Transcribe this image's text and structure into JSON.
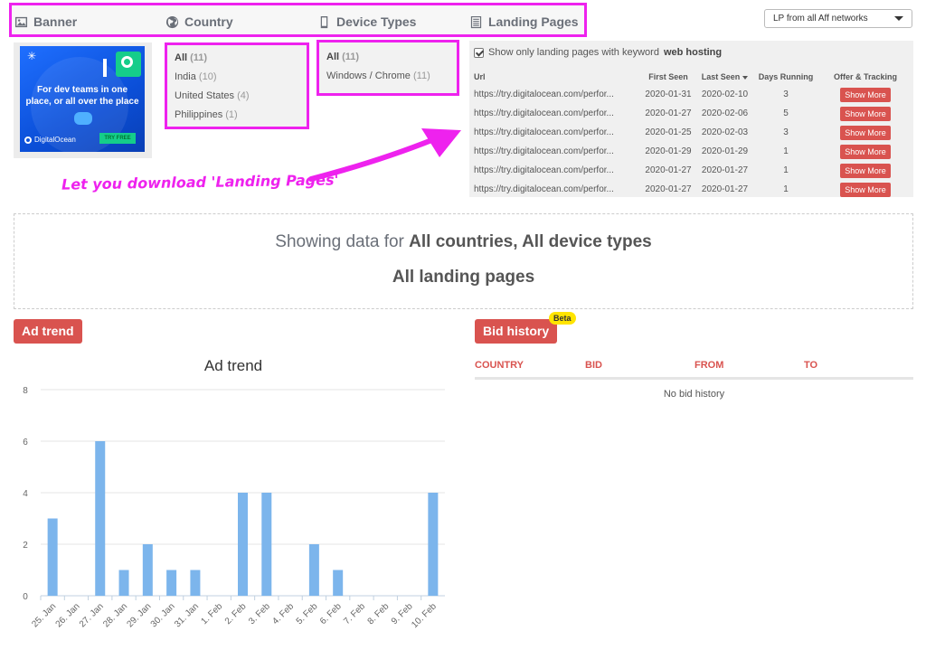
{
  "tabs": [
    {
      "label": "Banner",
      "icon": "image-icon"
    },
    {
      "label": "Country",
      "icon": "globe-icon"
    },
    {
      "label": "Device Types",
      "icon": "mobile-icon"
    },
    {
      "label": "Landing Pages",
      "icon": "list-icon"
    }
  ],
  "network_select": {
    "value": "LP from all Aff networks"
  },
  "banner": {
    "headline": "For dev teams in one place, or all over the place",
    "brand": "DigitalOcean",
    "cta": "TRY FREE"
  },
  "country_filter": [
    {
      "label": "All",
      "count": "(11)",
      "active": true
    },
    {
      "label": "India",
      "count": "(10)",
      "active": false
    },
    {
      "label": "United States",
      "count": "(4)",
      "active": false
    },
    {
      "label": "Philippines",
      "count": "(1)",
      "active": false
    }
  ],
  "device_filter": [
    {
      "label": "All",
      "count": "(11)",
      "active": true
    },
    {
      "label": "Windows / Chrome",
      "count": "(11)",
      "active": false
    }
  ],
  "landing_pages": {
    "checkbox_label": "Show only landing pages with keyword",
    "keyword": "web hosting",
    "columns": [
      "Url",
      "First Seen",
      "Last Seen",
      "Days Running",
      "Offer & Tracking"
    ],
    "rows": [
      {
        "url": "https://try.digitalocean.com/perfor...",
        "first_seen": "2020-01-31",
        "last_seen": "2020-02-10",
        "days": "3",
        "action": "Show More"
      },
      {
        "url": "https://try.digitalocean.com/perfor...",
        "first_seen": "2020-01-27",
        "last_seen": "2020-02-06",
        "days": "5",
        "action": "Show More"
      },
      {
        "url": "https://try.digitalocean.com/perfor...",
        "first_seen": "2020-01-25",
        "last_seen": "2020-02-03",
        "days": "3",
        "action": "Show More"
      },
      {
        "url": "https://try.digitalocean.com/perfor...",
        "first_seen": "2020-01-29",
        "last_seen": "2020-01-29",
        "days": "1",
        "action": "Show More"
      },
      {
        "url": "https://try.digitalocean.com/perfor...",
        "first_seen": "2020-01-27",
        "last_seen": "2020-01-27",
        "days": "1",
        "action": "Show More"
      },
      {
        "url": "https://try.digitalocean.com/perfor...",
        "first_seen": "2020-01-27",
        "last_seen": "2020-01-27",
        "days": "1",
        "action": "Show More"
      }
    ]
  },
  "annotation": {
    "text": "Let you download 'Landing Pages'"
  },
  "showing": {
    "prefix": "Showing data for",
    "selection": "All countries, All device types",
    "pages": "All landing pages"
  },
  "ad_trend": {
    "button": "Ad trend"
  },
  "bid_history": {
    "button": "Bid history",
    "badge": "Beta",
    "columns": [
      "COUNTRY",
      "BID",
      "FROM",
      "TO"
    ],
    "empty": "No bid history"
  },
  "colors": {
    "accent": "#d9534f",
    "highlight": "#ee22ee",
    "bar": "#7cb5ec",
    "beta": "#ffe400"
  },
  "chart_data": {
    "type": "bar",
    "title": "Ad trend",
    "categories": [
      "25. Jan",
      "26. Jan",
      "27. Jan",
      "28. Jan",
      "29. Jan",
      "30. Jan",
      "31. Jan",
      "1. Feb",
      "2. Feb",
      "3. Feb",
      "4. Feb",
      "5. Feb",
      "6. Feb",
      "7. Feb",
      "8. Feb",
      "9. Feb",
      "10. Feb"
    ],
    "values": [
      3,
      0,
      6,
      1,
      2,
      1,
      1,
      0,
      4,
      4,
      0,
      2,
      1,
      0,
      0,
      0,
      4
    ],
    "ylim": [
      0,
      8
    ],
    "yticks": [
      0,
      2,
      4,
      6,
      8
    ],
    "grid": true,
    "legend": "none"
  }
}
